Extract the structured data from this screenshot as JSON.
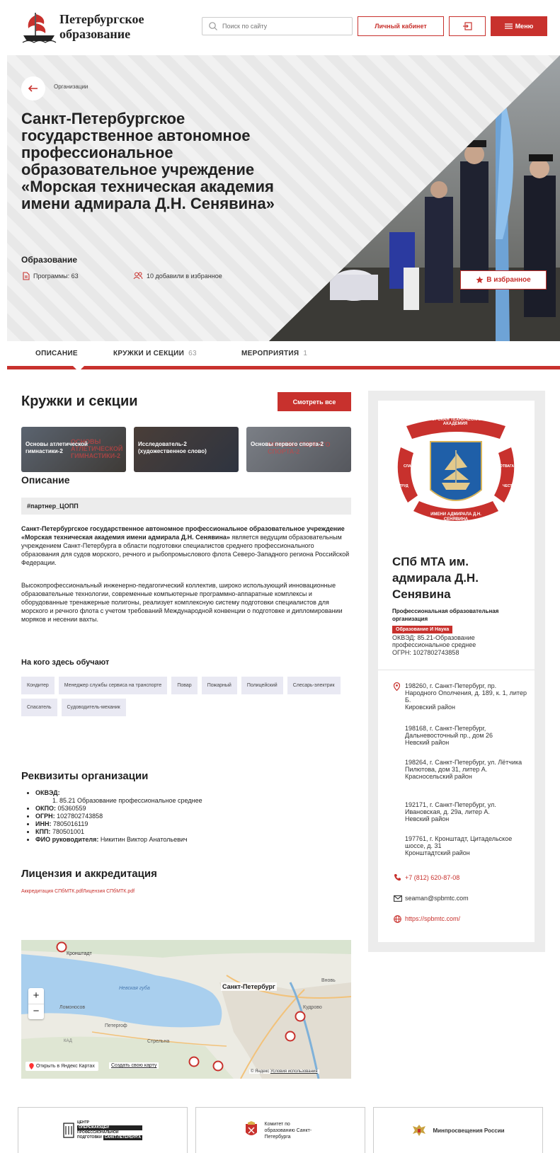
{
  "header": {
    "logo_line1": "Петербургское",
    "logo_line2": "образование",
    "search_placeholder": "Поиск по сайту",
    "cabinet_label": "Личный кабинет",
    "menu_label": "Меню"
  },
  "hero": {
    "breadcrumb": "Организации",
    "title": "Санкт-Петербургское государственное автономное профессиональное образовательное учреждение «Морская техническая академия имени адмирала Д.Н. Сенявина»",
    "category": "Образование",
    "programs": "Программы: 63",
    "favorites_count": "10 добавили в избранное",
    "favorite_button": "В избранное"
  },
  "tabs": [
    {
      "label": "ОПИСАНИЕ",
      "count": ""
    },
    {
      "label": "КРУЖКИ И СЕКЦИИ",
      "count": "63"
    },
    {
      "label": "МЕРОПРИЯТИЯ",
      "count": "1"
    }
  ],
  "circles": {
    "title": "Кружки и секции",
    "see_all": "Смотреть все",
    "cards": [
      {
        "title": "Основы атлетической гимнастики-2",
        "bg": "ОСНОВЫ АТЛЕТИЧЕСКОЙ ГИМНАСТИКИ-2"
      },
      {
        "title": "Исследователь-2 (художественное слово)",
        "bg": ""
      },
      {
        "title": "Основы первого спорта-2",
        "bg": "ОСНОВЫ ПЕРВОГО СПОРТА-2"
      }
    ]
  },
  "description": {
    "title": "Описание",
    "tag": "#партнер_ЦОПП",
    "p1_bold": "Санкт-Петербургское государственное автономное профессиональное образовательное учреждение «Морская техническая академия имени адмирала Д.Н. Сенявина»",
    "p1_rest": " является ведущим образовательным учреждением Санкт-Петербурга в области подготовки специалистов среднего профессионального образования для судов морского, речного и рыбопромыслового флота Северо-Западного региона Российской Федерации.",
    "p2": "Высокопрофессиональный инженерно-педагогический коллектив, широко использующий инновационные образовательные технологии, современные компьютерные программно-аппаратные комплексы и оборудованные тренажерные полигоны, реализует комплексную систему подготовки специалистов для морского и речного флота с учетом требований Международной конвенции о подготовке и дипломировании моряков и несении вахты."
  },
  "professions": {
    "title": "На кого здесь обучают",
    "items": [
      "Кондитер",
      "Менеджер службы сервиса на транспорте",
      "Повар",
      "Пожарный",
      "Полицейский",
      "Слесарь-электрик",
      "Спасатель",
      "Судоводитель-механик"
    ]
  },
  "requisites": {
    "title": "Реквизиты организации",
    "okved_label": "ОКВЭД:",
    "okved_item": "1. 85.21 Образование профессиональное среднее",
    "okpo_label": "ОКПО:",
    "okpo": " 05360559",
    "ogrn_label": "ОГРН:",
    "ogrn": " 1027802743858",
    "inn_label": "ИНН:",
    "inn": " 7805016119",
    "kpp_label": "КПП:",
    "kpp": " 780501001",
    "head_label": "ФИО руководителя:",
    "head": " Никитин Виктор Анатольевич"
  },
  "license": {
    "title": "Лицензия и аккредитация",
    "links": "Аккредитация СПбМТК.pdfЛицензия СПбМТК.pdf"
  },
  "map": {
    "labels": {
      "kronstadt": "Кронштадт",
      "spb": "Санкт-Петербург",
      "neva_bay": "Невская губа",
      "lomonosov": "Ломоносов",
      "peterhof": "Петергоф",
      "strelna": "Стрельна",
      "kudrovo": "Кудрово",
      "murino": "Вновь",
      "ringroad": "КАД"
    },
    "open_link": "Открыть в Яндекс Картах",
    "create_link": "Создать свою карту",
    "copyright": "© Яндекс",
    "terms": "Условия использования"
  },
  "sidebar": {
    "emblem_top": "МОРСКАЯ ТЕХНИЧЕСКАЯ АКАДЕМИЯ",
    "emblem_left": "СЛАВА",
    "emblem_right": "ОТВАГА",
    "emblem_left2": "ТРУД",
    "emblem_right2": "ЧЕСТЬ",
    "emblem_bottom": "ИМЕНИ АДМИРАЛА Д.Н. СЕНЯВИНА",
    "short_name": "СПб МТА им. адмирала Д.Н. Сенявина",
    "type": "Профессиональная образовательная организация",
    "badge": "Образование И Наука",
    "okved": "ОКВЭД: 85.21-Образование профессиональное среднее",
    "ogrn": "ОГРН: 1027802743858",
    "addresses": [
      "198260, г. Санкт-Петербург, пр. Народного Ополчения, д. 189, к. 1, литер Б.\nКировский район",
      "198168, г. Санкт-Петербург, Дальневосточный пр., дом 26\nНевский район",
      "198264, г. Санкт-Петербург, ул. Лётчика Пилютова, дом 31, литер А.\nКрасносельский район",
      "192171, г. Санкт-Петербург, ул. Ивановская, д. 29а, литер А.\nНевский район",
      "197761, г. Кронштадт, Цитадельское шоссе, д. 31\nКронштадтский район"
    ],
    "phone": "+7 (812) 620-87-08",
    "email": "seaman@spbmtc.com",
    "website": "https://spbmtc.com/"
  },
  "footer": {
    "center_lines": [
      "ЦЕНТР",
      "ОПЕРЕЖАЮЩЕЙ",
      "ПРОФЕССИОНАЛЬНОЙ",
      "ПОДГОТОВКИ",
      "САНКТ-ПЕТЕРБУРГА"
    ],
    "committee": "Комитет по образованию Санкт-Петербурга",
    "ministry": "Минпросвещения России"
  },
  "colors": {
    "accent": "#c8312d",
    "panel": "#ececec",
    "chip": "#e9e9f3"
  }
}
